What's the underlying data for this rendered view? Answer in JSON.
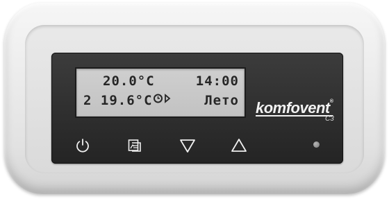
{
  "device": {
    "brand": "komfovent",
    "model": "C3"
  },
  "lcd": {
    "line1_left": "20.0°C",
    "line1_right": "14:00",
    "line2_left": "2 19.6°C",
    "line2_right": "Лето"
  },
  "icons": {
    "mode": "clock-icon",
    "indicator": "play-icon"
  },
  "buttons": [
    {
      "name": "power-button",
      "icon": "power-icon"
    },
    {
      "name": "menu-button",
      "icon": "menu-icon"
    },
    {
      "name": "down-button",
      "icon": "triangle-down-icon"
    },
    {
      "name": "up-button",
      "icon": "triangle-up-icon"
    }
  ],
  "colors": {
    "panel": "#2a2a2a",
    "lcd": "#c8c8c8",
    "lcd_text": "#262626",
    "housing": "#e6e6e6"
  }
}
